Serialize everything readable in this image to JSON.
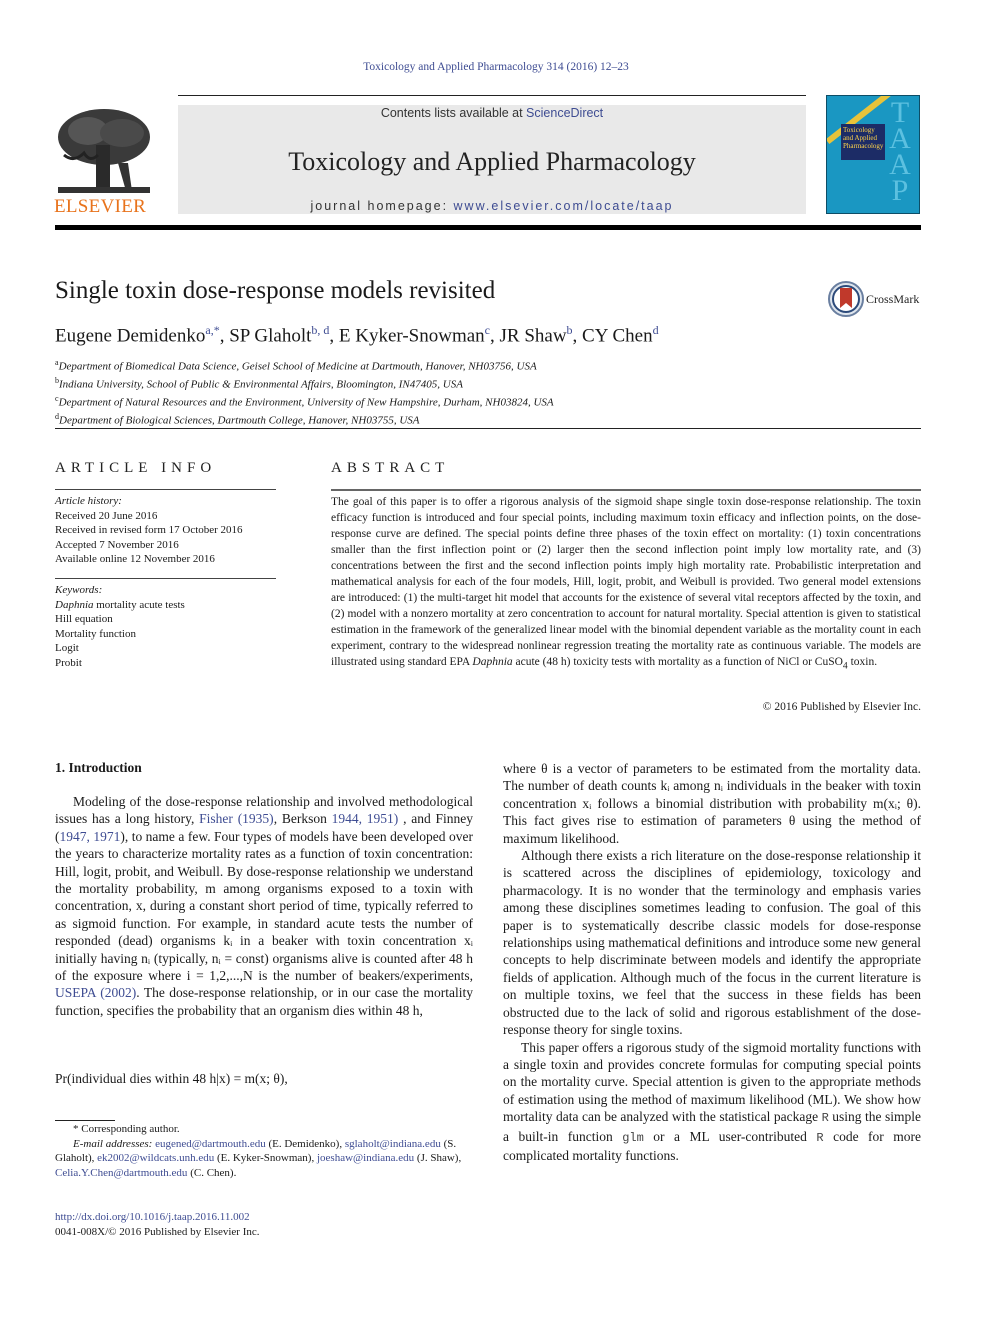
{
  "header": {
    "journal_ref": "Toxicology and Applied Pharmacology 314 (2016) 12–23",
    "contents_prefix": "Contents lists available at ",
    "contents_link": "ScienceDirect",
    "journal_title": "Toxicology and Applied Pharmacology",
    "homepage_prefix": "journal homepage: ",
    "homepage_link": "www.elsevier.com/locate/taap",
    "publisher_logo_text": "ELSEVIER",
    "cover_letters": "TAAP",
    "cover_title": "Toxicology and Applied Pharmacology",
    "brand_color": "#e8731c",
    "link_color": "#3e4c92",
    "cover_color": "#1a97c2"
  },
  "article": {
    "title": "Single toxin dose-response models revisited",
    "crossmark_label": "CrossMark",
    "authors": [
      {
        "name": "Eugene Demidenko",
        "sup": "a,*"
      },
      {
        "name": "SP Glaholt",
        "sup": "b, d"
      },
      {
        "name": "E Kyker-Snowman",
        "sup": "c"
      },
      {
        "name": "JR Shaw",
        "sup": "b"
      },
      {
        "name": "CY Chen",
        "sup": "d"
      }
    ],
    "affiliations": [
      {
        "key": "a",
        "text": "Department of Biomedical Data Science, Geisel School of Medicine at Dartmouth, Hanover, NH03756, USA"
      },
      {
        "key": "b",
        "text": "Indiana University, School of Public & Environmental Affairs, Bloomington, IN47405, USA"
      },
      {
        "key": "c",
        "text": "Department of Natural Resources and the Environment, University of New Hampshire, Durham, NH03824, USA"
      },
      {
        "key": "d",
        "text": "Department of Biological Sciences, Dartmouth College, Hanover, NH03755, USA"
      }
    ]
  },
  "article_info": {
    "heading": "ARTICLE INFO",
    "history_label": "Article history:",
    "history": [
      "Received 20 June 2016",
      "Received in revised form 17 October 2016",
      "Accepted 7 November 2016",
      "Available online 12 November 2016"
    ],
    "keywords_label": "Keywords:",
    "keyword_first_italic": "Daphnia",
    "keyword_first_rest": " mortality acute tests",
    "keywords": [
      "Hill equation",
      "Mortality function",
      "Logit",
      "Probit"
    ]
  },
  "abstract": {
    "heading": "ABSTRACT",
    "text_part1": "The goal of this paper is to offer a rigorous analysis of the sigmoid shape single toxin dose-response relationship. The toxin efficacy function is introduced and four special points, including maximum toxin efficacy and inflection points, on the dose-response curve are defined. The special points define three phases of the toxin effect on mortality: (1) toxin concentrations smaller than the first inflection point or (2) larger then the second inflection point imply low mortality rate, and (3) concentrations between the first and the second inflection points imply high mortality rate. Probabilistic interpretation and mathematical analysis for each of the four models, Hill, logit, probit, and Weibull is provided. Two general model extensions are introduced: (1) the multi-target hit model that accounts for the existence of several vital receptors affected by the toxin, and (2) model with a nonzero mortality at zero concentration to account for natural mortality. Special attention is given to statistical estimation in the framework of the generalized linear model with the binomial dependent variable as the mortality count in each experiment, contrary to the widespread nonlinear regression treating the mortality rate as continuous variable. The models are illustrated using standard EPA ",
    "text_italic": "Daphnia",
    "text_part2": " acute (48 h) toxicity tests with mortality as a function of NiCl or CuSO",
    "text_sub": "4",
    "text_part3": " toxin.",
    "copyright": "© 2016 Published by Elsevier Inc."
  },
  "body": {
    "section_heading": "1.  Introduction",
    "left_p1_a": "Modeling of the dose-response relationship and involved methodological issues has a long history, ",
    "left_p1_ref1": "Fisher (1935)",
    "left_p1_b": ", Berkson ",
    "left_p1_ref2": "1944, 1951)",
    "left_p1_c": " , and Finney (",
    "left_p1_ref3": "1947, 1971",
    "left_p1_d": "), to name a few. Four types of models have been developed over the years to characterize mortality rates as a function of toxin concentration: Hill, logit, probit, and Weibull. By dose-response relationship we understand the mortality probability, m among organisms exposed to a toxin with concentration, x, during a constant short period of time, typically referred to as sigmoid function. For example, in standard acute tests the number of responded (dead) organisms kᵢ in a beaker with toxin concentration xᵢ initially having nᵢ (typically, nᵢ = const) organisms alive is counted after 48 h of the exposure where i = 1,2,...,N is the number of beakers/experiments, ",
    "left_p1_ref4": "USEPA (2002)",
    "left_p1_e": ". The dose-response relationship, or in our case the mortality function, specifies the probability that an organism dies within 48 h,",
    "equation": "Pr(individual dies within 48 h|x) = m(x; θ),",
    "right_p1": "where θ is a vector of parameters to be estimated from the mortality data. The number of death counts kᵢ among nᵢ individuals in the beaker with toxin concentration xᵢ follows a binomial distribution with probability m(xᵢ; θ). This fact gives rise to estimation of parameters θ using the method of maximum likelihood.",
    "right_p2": "Although there exists a rich literature on the dose-response relationship it is scattered across the disciplines of epidemiology, toxicology and pharmacology. It is no wonder that the terminology and emphasis varies among these disciplines sometimes leading to confusion. The goal of this paper is to systematically describe classic models for dose-response relationships using mathematical definitions and introduce some new general concepts to help discriminate between models and identify the appropriate fields of application. Although much of the focus in the current literature is on multiple toxins, we feel that the success in these fields has been obstructed due to the lack of solid and rigorous establishment of the dose-response theory for single toxins.",
    "right_p3_a": "This paper offers a rigorous study of the sigmoid mortality functions with a single toxin and provides concrete formulas for computing special points on the mortality curve. Special attention is given to the appropriate methods of estimation using the method of maximum likelihood (ML). We show how mortality data can be analyzed with the statistical package ",
    "right_p3_code1": "R",
    "right_p3_b": " using the simple a built-in function ",
    "right_p3_code2": "glm",
    "right_p3_c": " or a ML user-contributed ",
    "right_p3_code3": "R",
    "right_p3_d": " code for more complicated mortality functions."
  },
  "footnote": {
    "corresponding": "* Corresponding author.",
    "email_label": "E-mail addresses: ",
    "emails": [
      {
        "email": "eugened@dartmouth.edu",
        "name": " (E. Demidenko), "
      },
      {
        "email": "sglaholt@indiana.edu",
        "name": " (S. Glaholt), "
      },
      {
        "email": "ek2002@wildcats.unh.edu",
        "name": " (E. Kyker-Snowman), "
      },
      {
        "email": "joeshaw@indiana.edu",
        "name": " (J. Shaw), "
      },
      {
        "email": "Celia.Y.Chen@dartmouth.edu",
        "name": " (C. Chen)."
      }
    ],
    "doi": "http://dx.doi.org/10.1016/j.taap.2016.11.002",
    "issn_line": "0041-008X/© 2016 Published by Elsevier Inc."
  }
}
